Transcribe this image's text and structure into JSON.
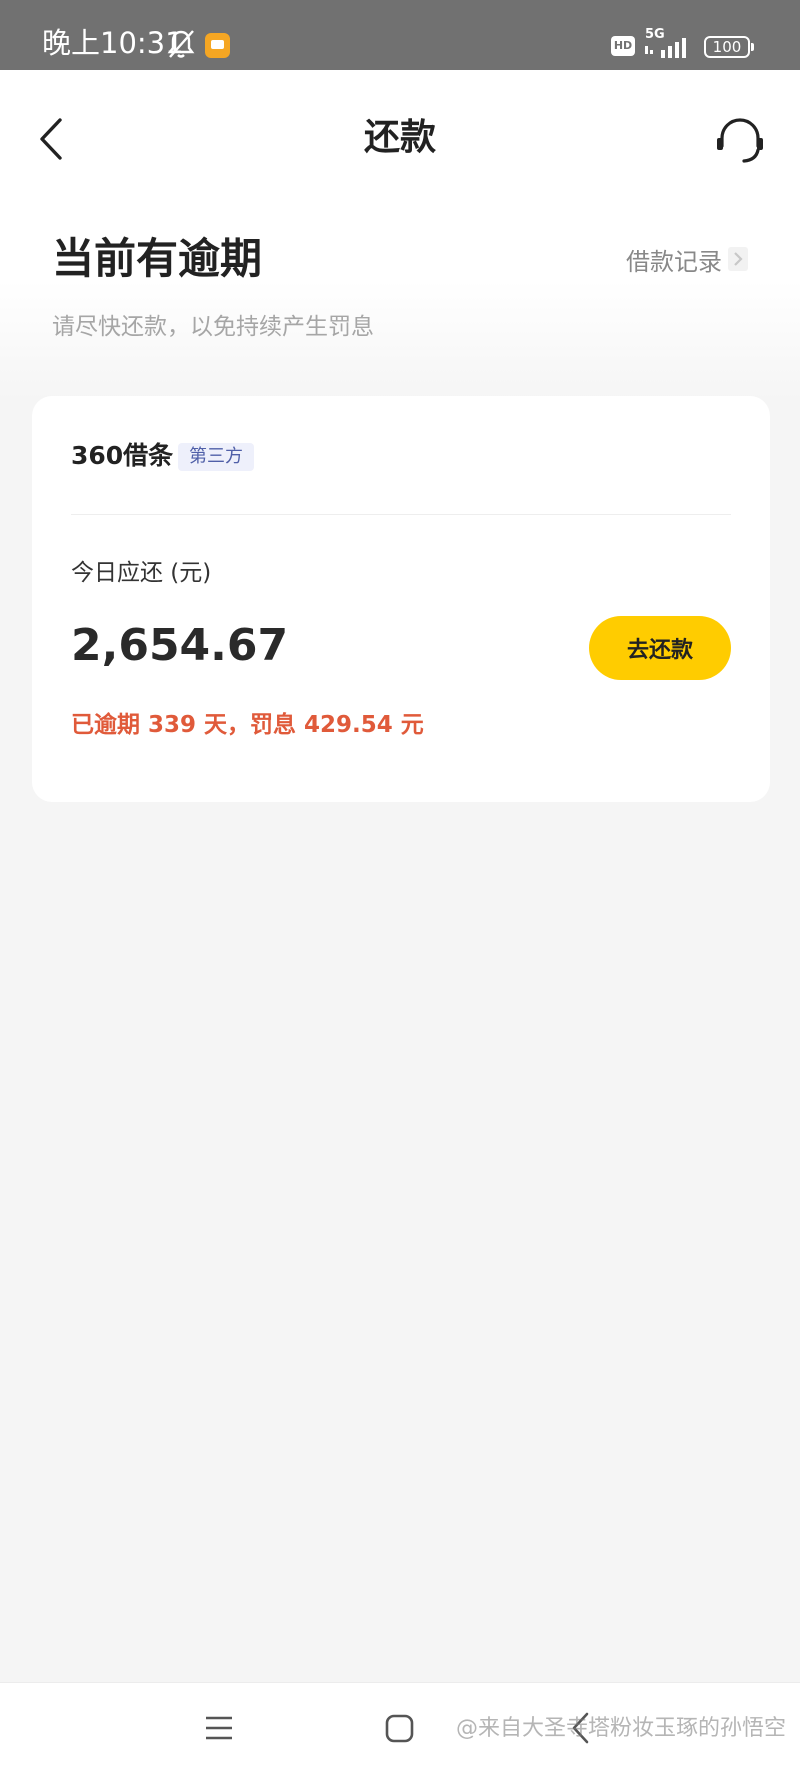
{
  "status_bar": {
    "time": "晚上10:31",
    "hd_label": "HD",
    "network": "5G",
    "battery": "100"
  },
  "header": {
    "title": "还款",
    "back_icon": "chevron-left-icon",
    "support_icon": "headset-icon"
  },
  "hero": {
    "title": "当前有逾期",
    "subtitle": "请尽快还款，以免持续产生罚息",
    "records_link": "借款记录"
  },
  "card": {
    "product_name": "360借条",
    "badge": "第三方",
    "due_label": "今日应还 (元)",
    "amount": "2,654.67",
    "repay_button": "去还款",
    "overdue_text": "已逾期 339 天，罚息 429.54 元"
  },
  "watermark": "@来自大圣寺塔粉妆玉琢的孙悟空",
  "colors": {
    "accent": "#ffcc00",
    "overdue": "#e05a3a",
    "badge_bg": "#eef0fb",
    "badge_text": "#4f5fa8",
    "status_bar": "#717171"
  }
}
